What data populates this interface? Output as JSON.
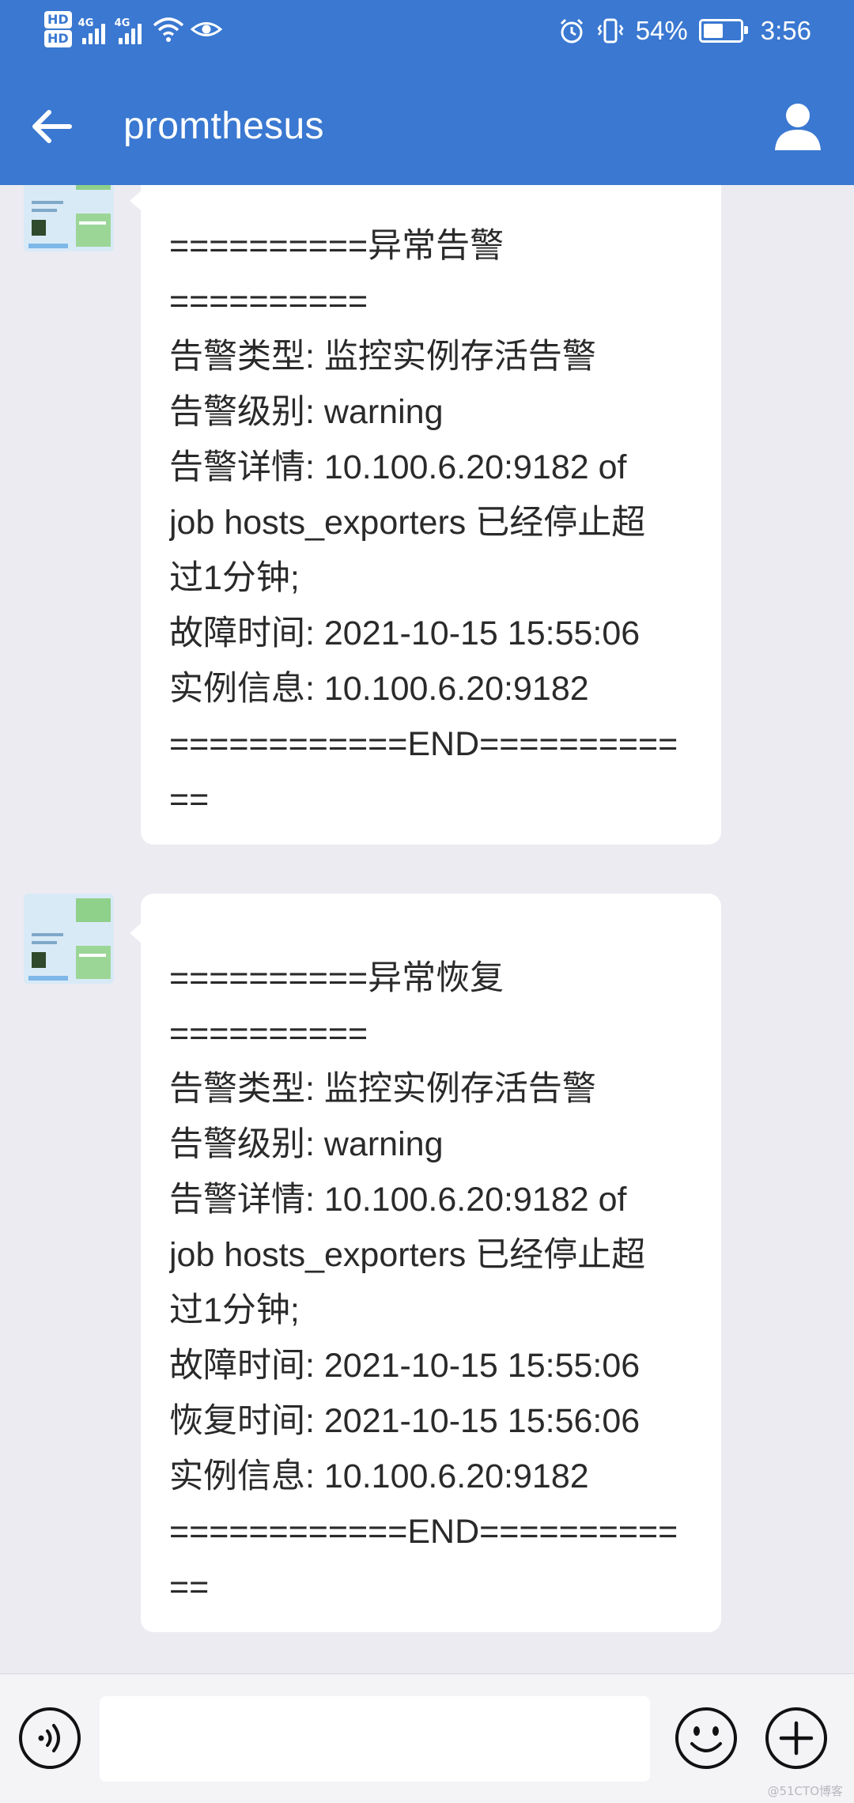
{
  "status_bar": {
    "hd1": "HD",
    "hd2": "HD",
    "net1": "4G",
    "net2": "4G",
    "battery_text": "54%",
    "battery_level": 0.54,
    "time": "3:56"
  },
  "app_bar": {
    "title": "promthesus",
    "back_icon": "arrow-left-icon",
    "profile_icon": "user-icon"
  },
  "messages": [
    {
      "lines": [
        "==========异常告警",
        "==========",
        "告警类型: 监控实例存活告警",
        "告警级别: warning",
        "告警详情: 10.100.6.20:9182 of",
        "job hosts_exporters 已经停止超",
        "过1分钟;",
        "故障时间: 2021-10-15 15:55:06",
        "实例信息: 10.100.6.20:9182",
        "============END==========",
        "=="
      ]
    },
    {
      "lines": [
        "==========异常恢复",
        "==========",
        "告警类型: 监控实例存活告警",
        "告警级别: warning",
        "告警详情: 10.100.6.20:9182 of",
        "job hosts_exporters 已经停止超",
        "过1分钟;",
        "故障时间: 2021-10-15 15:55:06",
        "恢复时间: 2021-10-15 15:56:06",
        "实例信息: 10.100.6.20:9182",
        "============END==========",
        "=="
      ]
    }
  ],
  "input_bar": {
    "voice_icon": "voice-icon",
    "emoji_icon": "smiley-icon",
    "plus_icon": "plus-icon",
    "input_value": ""
  },
  "colors": {
    "accent": "#3a78d1",
    "background": "#ebebf1"
  },
  "watermark": "@51CTO博客"
}
